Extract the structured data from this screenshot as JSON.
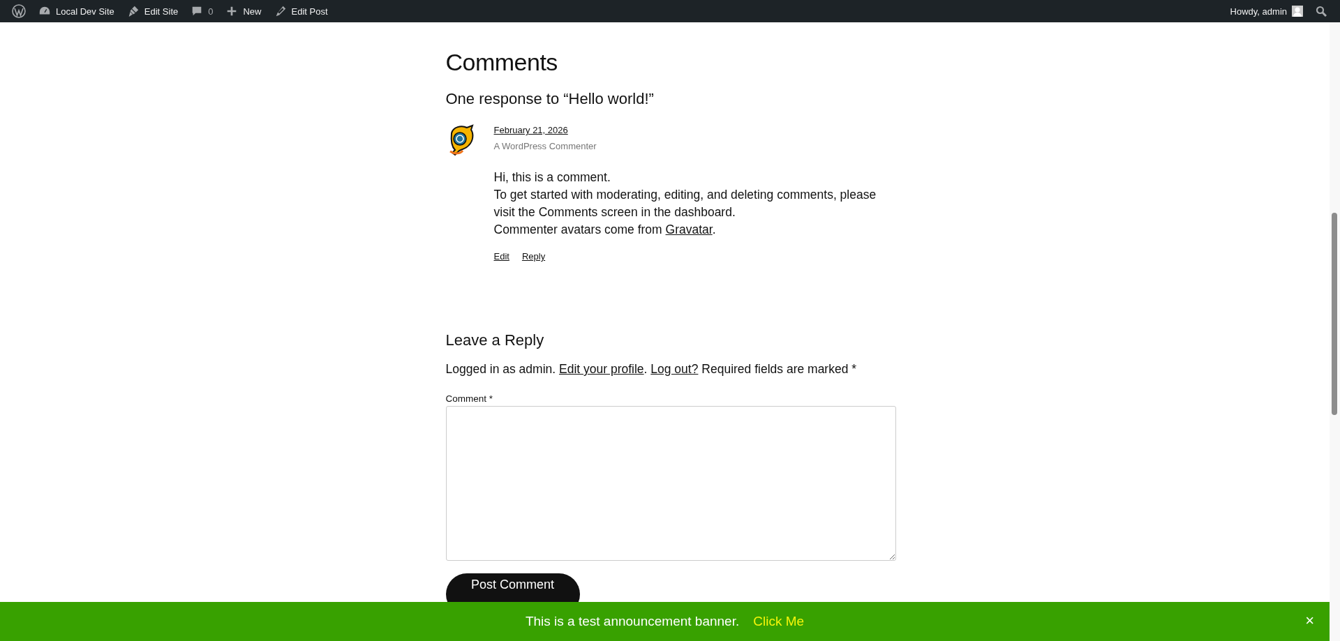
{
  "admin_bar": {
    "left": [
      {
        "kind": "logo"
      },
      {
        "kind": "dashboard",
        "label": "Local Dev Site"
      },
      {
        "kind": "brush",
        "label": "Edit Site"
      },
      {
        "kind": "comments",
        "label": "0"
      },
      {
        "kind": "plus",
        "label": "New"
      },
      {
        "kind": "pencil",
        "label": "Edit Post"
      }
    ],
    "greeting": "Howdy, admin"
  },
  "comments": {
    "title": "Comments",
    "subtitle": "One response to “Hello world!”",
    "items": [
      {
        "date": "February 21, 2026",
        "author": "A WordPress Commenter",
        "lines": [
          "Hi, this is a comment.",
          "To get started with moderating, editing, and deleting comments, please visit the Comments screen in the dashboard."
        ],
        "last_line": {
          "before": "Commenter avatars come from ",
          "link": "Gravatar",
          "after": "."
        },
        "actions": [
          "Edit",
          "Reply"
        ]
      }
    ]
  },
  "reply": {
    "title": "Leave a Reply",
    "notice": {
      "before": "Logged in as admin. ",
      "profile_link": "Edit your profile",
      "middle": ". ",
      "logout_link": "Log out?",
      "after": " Required fields are marked *"
    },
    "comment_label": "Comment *",
    "submit": "Post Comment"
  },
  "banner": {
    "text": "This is a test announcement banner.",
    "link": "Click Me",
    "close": "×"
  }
}
